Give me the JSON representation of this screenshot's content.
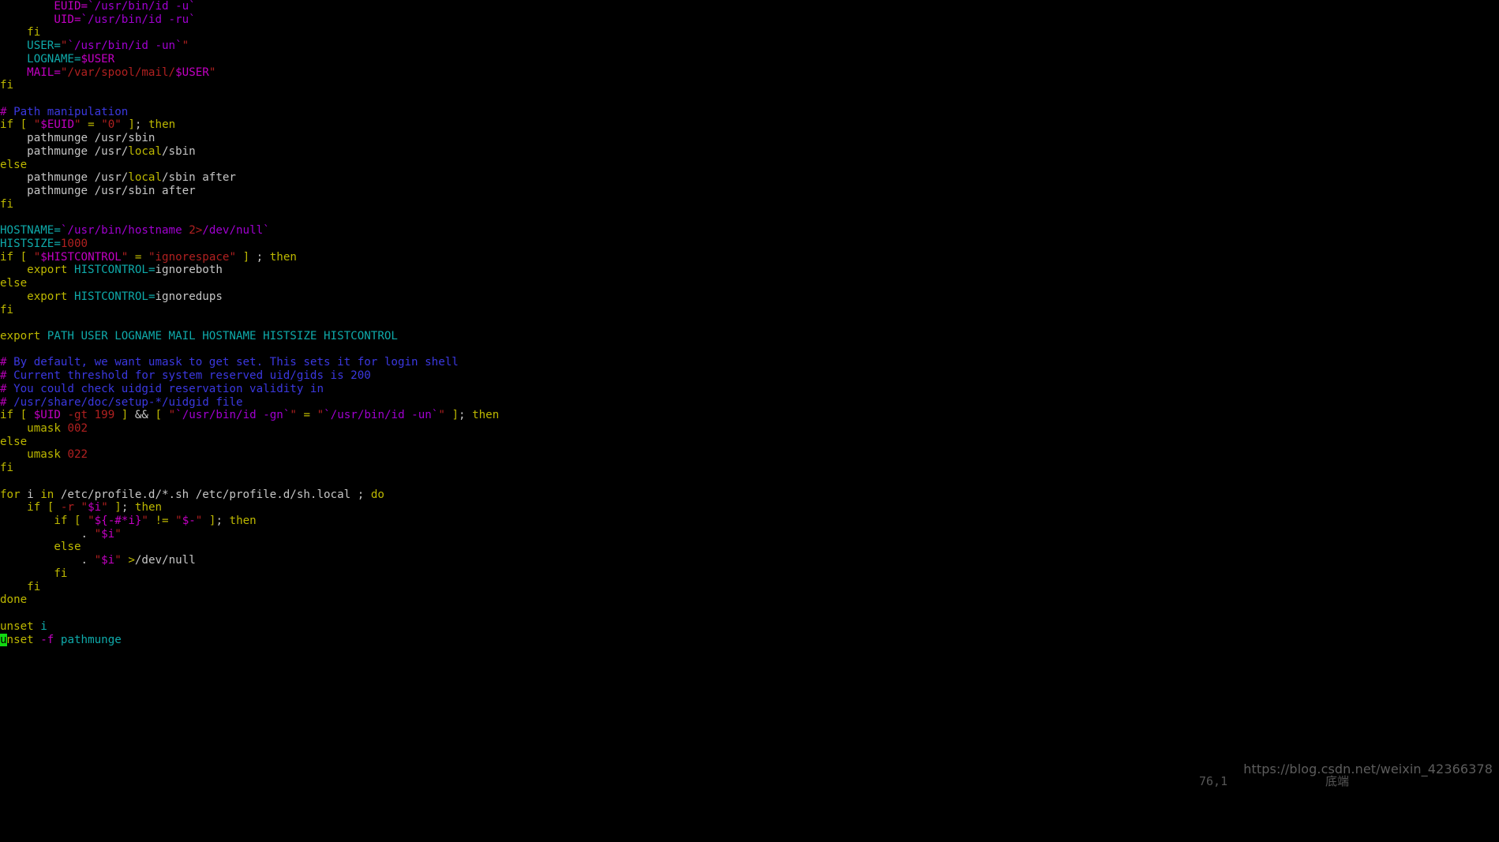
{
  "app": {
    "kind": "terminal-text-editor",
    "editor": "vim",
    "background": "#000000",
    "file_language": "shell"
  },
  "palette": {
    "keyword": "#bdb800",
    "comment": "#3b38e0",
    "comment_hash": "#b000b0",
    "identifier": "#0faaaa",
    "variable": "#c300c3",
    "string": "#b02020",
    "number": "#b02020",
    "backquote": "#a000d0",
    "plain": "#c6c6c6",
    "cursor": "#12d912"
  },
  "statusline": {
    "position": "76,1",
    "scroll": "底端"
  },
  "watermark": {
    "text": "https://blog.csdn.net/weixin_42366378"
  },
  "cursor": {
    "line": 76,
    "column": 1,
    "char": "u"
  },
  "buffer": {
    "lines": [
      "        EUID=`/usr/bin/id -u`",
      "        UID=`/usr/bin/id -ru`",
      "    fi",
      "    USER=\"`/usr/bin/id -un`\"",
      "    LOGNAME=$USER",
      "    MAIL=\"/var/spool/mail/$USER\"",
      "fi",
      "",
      "# Path manipulation",
      "if [ \"$EUID\" = \"0\" ]; then",
      "    pathmunge /usr/sbin",
      "    pathmunge /usr/local/sbin",
      "else",
      "    pathmunge /usr/local/sbin after",
      "    pathmunge /usr/sbin after",
      "fi",
      "",
      "HOSTNAME=`/usr/bin/hostname 2>/dev/null`",
      "HISTSIZE=1000",
      "if [ \"$HISTCONTROL\" = \"ignorespace\" ] ; then",
      "    export HISTCONTROL=ignoreboth",
      "else",
      "    export HISTCONTROL=ignoredups",
      "fi",
      "",
      "export PATH USER LOGNAME MAIL HOSTNAME HISTSIZE HISTCONTROL",
      "",
      "# By default, we want umask to get set. This sets it for login shell",
      "# Current threshold for system reserved uid/gids is 200",
      "# You could check uidgid reservation validity in",
      "# /usr/share/doc/setup-*/uidgid file",
      "if [ $UID -gt 199 ] && [ \"`/usr/bin/id -gn`\" = \"`/usr/bin/id -un`\" ]; then",
      "    umask 002",
      "else",
      "    umask 022",
      "fi",
      "",
      "for i in /etc/profile.d/*.sh /etc/profile.d/sh.local ; do",
      "    if [ -r \"$i\" ]; then",
      "        if [ \"${-#*i}\" != \"$-\" ]; then",
      "            . \"$i\"",
      "        else",
      "            . \"$i\" >/dev/null",
      "        fi",
      "    fi",
      "done",
      "",
      "unset i",
      "unset -f pathmunge"
    ],
    "tokens": [
      [
        [
          "plain",
          "        "
        ],
        [
          "var",
          "EUID"
        ],
        [
          "var",
          "="
        ],
        [
          "bq",
          "`/usr/bin/id -u`"
        ]
      ],
      [
        [
          "plain",
          "        "
        ],
        [
          "var",
          "UID"
        ],
        [
          "var",
          "="
        ],
        [
          "bq",
          "`/usr/bin/id -ru`"
        ]
      ],
      [
        [
          "plain",
          "    "
        ],
        [
          "kw",
          "fi"
        ]
      ],
      [
        [
          "plain",
          "    "
        ],
        [
          "ident",
          "USER"
        ],
        [
          "ident",
          "="
        ],
        [
          "str",
          "\""
        ],
        [
          "bq",
          "`/usr/bin/id -un`"
        ],
        [
          "str",
          "\""
        ]
      ],
      [
        [
          "plain",
          "    "
        ],
        [
          "ident",
          "LOGNAME"
        ],
        [
          "ident",
          "="
        ],
        [
          "var",
          "$USER"
        ]
      ],
      [
        [
          "plain",
          "    "
        ],
        [
          "var",
          "MAIL"
        ],
        [
          "var",
          "="
        ],
        [
          "str",
          "\"/var/spool/mail/"
        ],
        [
          "var",
          "$USER"
        ],
        [
          "str",
          "\""
        ]
      ],
      [
        [
          "kw",
          "fi"
        ]
      ],
      [
        [
          "plain",
          ""
        ]
      ],
      [
        [
          "cmth",
          "#"
        ],
        [
          "cmt",
          " Path manipulation"
        ]
      ],
      [
        [
          "kw",
          "if"
        ],
        [
          "plain",
          " "
        ],
        [
          "op",
          "["
        ],
        [
          "plain",
          " "
        ],
        [
          "str",
          "\""
        ],
        [
          "var",
          "$EUID"
        ],
        [
          "str",
          "\""
        ],
        [
          "plain",
          " "
        ],
        [
          "op",
          "="
        ],
        [
          "plain",
          " "
        ],
        [
          "str",
          "\"0\""
        ],
        [
          "plain",
          " "
        ],
        [
          "op",
          "]"
        ],
        [
          "plain",
          ";"
        ],
        [
          "plain",
          " "
        ],
        [
          "kw",
          "then"
        ]
      ],
      [
        [
          "plain",
          "    pathmunge /usr/"
        ],
        [
          "plain",
          "sbin"
        ]
      ],
      [
        [
          "plain",
          "    pathmunge /usr/"
        ],
        [
          "pth",
          "local"
        ],
        [
          "plain",
          "/sbin"
        ]
      ],
      [
        [
          "kw",
          "else"
        ]
      ],
      [
        [
          "plain",
          "    pathmunge /usr/"
        ],
        [
          "pth",
          "local"
        ],
        [
          "plain",
          "/sbin after"
        ]
      ],
      [
        [
          "plain",
          "    pathmunge /usr/sbin after"
        ]
      ],
      [
        [
          "kw",
          "fi"
        ]
      ],
      [
        [
          "plain",
          ""
        ]
      ],
      [
        [
          "ident",
          "HOSTNAME"
        ],
        [
          "ident",
          "="
        ],
        [
          "bq",
          "`/usr/bin/hostname "
        ],
        [
          "redir",
          "2>"
        ],
        [
          "bq",
          "/dev/null`"
        ]
      ],
      [
        [
          "ident",
          "HISTSIZE"
        ],
        [
          "ident",
          "="
        ],
        [
          "num",
          "1000"
        ]
      ],
      [
        [
          "kw",
          "if"
        ],
        [
          "plain",
          " "
        ],
        [
          "op",
          "["
        ],
        [
          "plain",
          " "
        ],
        [
          "str",
          "\""
        ],
        [
          "var",
          "$HISTCONTROL"
        ],
        [
          "str",
          "\""
        ],
        [
          "plain",
          " "
        ],
        [
          "op",
          "="
        ],
        [
          "plain",
          " "
        ],
        [
          "str",
          "\"ignorespace\""
        ],
        [
          "plain",
          " "
        ],
        [
          "op",
          "]"
        ],
        [
          "plain",
          " ;"
        ],
        [
          "plain",
          " "
        ],
        [
          "kw",
          "then"
        ]
      ],
      [
        [
          "plain",
          "    "
        ],
        [
          "kw",
          "export"
        ],
        [
          "plain",
          " "
        ],
        [
          "ident",
          "HISTCONTROL"
        ],
        [
          "ident",
          "="
        ],
        [
          "plain",
          "ignoreboth"
        ]
      ],
      [
        [
          "kw",
          "else"
        ]
      ],
      [
        [
          "plain",
          "    "
        ],
        [
          "kw",
          "export"
        ],
        [
          "plain",
          " "
        ],
        [
          "ident",
          "HISTCONTROL"
        ],
        [
          "ident",
          "="
        ],
        [
          "plain",
          "ignoredups"
        ]
      ],
      [
        [
          "kw",
          "fi"
        ]
      ],
      [
        [
          "plain",
          ""
        ]
      ],
      [
        [
          "kw",
          "export"
        ],
        [
          "plain",
          " "
        ],
        [
          "ident",
          "PATH USER LOGNAME MAIL HOSTNAME HISTSIZE HISTCONTROL"
        ]
      ],
      [
        [
          "plain",
          ""
        ]
      ],
      [
        [
          "cmth",
          "#"
        ],
        [
          "cmt",
          " By default, we want umask to get set. This sets it for login shell"
        ]
      ],
      [
        [
          "cmth",
          "#"
        ],
        [
          "cmt",
          " Current threshold for system reserved uid/gids is 200"
        ]
      ],
      [
        [
          "cmth",
          "#"
        ],
        [
          "cmt",
          " You could check uidgid reservation validity in"
        ]
      ],
      [
        [
          "cmth",
          "#"
        ],
        [
          "cmt",
          " /usr/share/doc/setup-*/uidgid file"
        ]
      ],
      [
        [
          "kw",
          "if"
        ],
        [
          "plain",
          " "
        ],
        [
          "op",
          "["
        ],
        [
          "plain",
          " "
        ],
        [
          "var",
          "$UID"
        ],
        [
          "plain",
          " "
        ],
        [
          "opt",
          "-gt"
        ],
        [
          "plain",
          " "
        ],
        [
          "num",
          "199"
        ],
        [
          "plain",
          " "
        ],
        [
          "op",
          "]"
        ],
        [
          "plain",
          " "
        ],
        [
          "plain",
          "&&"
        ],
        [
          "plain",
          " "
        ],
        [
          "op",
          "["
        ],
        [
          "plain",
          " "
        ],
        [
          "str",
          "\""
        ],
        [
          "bq",
          "`/usr/bin/id -gn`"
        ],
        [
          "str",
          "\""
        ],
        [
          "plain",
          " "
        ],
        [
          "op",
          "="
        ],
        [
          "plain",
          " "
        ],
        [
          "str",
          "\""
        ],
        [
          "bq",
          "`/usr/bin/id -un`"
        ],
        [
          "str",
          "\""
        ],
        [
          "plain",
          " "
        ],
        [
          "op",
          "]"
        ],
        [
          "plain",
          ";"
        ],
        [
          "plain",
          " "
        ],
        [
          "kw",
          "then"
        ]
      ],
      [
        [
          "plain",
          "    "
        ],
        [
          "kw",
          "umask"
        ],
        [
          "plain",
          " "
        ],
        [
          "num",
          "002"
        ]
      ],
      [
        [
          "kw",
          "else"
        ]
      ],
      [
        [
          "plain",
          "    "
        ],
        [
          "kw",
          "umask"
        ],
        [
          "plain",
          " "
        ],
        [
          "num",
          "022"
        ]
      ],
      [
        [
          "kw",
          "fi"
        ]
      ],
      [
        [
          "plain",
          ""
        ]
      ],
      [
        [
          "kw",
          "for"
        ],
        [
          "plain",
          " i "
        ],
        [
          "kw",
          "in"
        ],
        [
          "plain",
          " /etc/profile.d/*.sh /etc/profile.d/sh.local ; "
        ],
        [
          "kw",
          "do"
        ]
      ],
      [
        [
          "plain",
          "    "
        ],
        [
          "kw",
          "if"
        ],
        [
          "plain",
          " "
        ],
        [
          "op",
          "["
        ],
        [
          "plain",
          " "
        ],
        [
          "opt",
          "-r"
        ],
        [
          "plain",
          " "
        ],
        [
          "str",
          "\""
        ],
        [
          "var",
          "$i"
        ],
        [
          "str",
          "\""
        ],
        [
          "plain",
          " "
        ],
        [
          "op",
          "]"
        ],
        [
          "plain",
          ";"
        ],
        [
          "plain",
          " "
        ],
        [
          "kw",
          "then"
        ]
      ],
      [
        [
          "plain",
          "        "
        ],
        [
          "kw",
          "if"
        ],
        [
          "plain",
          " "
        ],
        [
          "op",
          "["
        ],
        [
          "plain",
          " "
        ],
        [
          "str",
          "\""
        ],
        [
          "var",
          "${-#*i}"
        ],
        [
          "str",
          "\""
        ],
        [
          "plain",
          " "
        ],
        [
          "op",
          "!="
        ],
        [
          "plain",
          " "
        ],
        [
          "str",
          "\""
        ],
        [
          "var",
          "$-"
        ],
        [
          "str",
          "\""
        ],
        [
          "plain",
          " "
        ],
        [
          "op",
          "]"
        ],
        [
          "plain",
          ";"
        ],
        [
          "plain",
          " "
        ],
        [
          "kw",
          "then"
        ]
      ],
      [
        [
          "plain",
          "            . "
        ],
        [
          "str",
          "\""
        ],
        [
          "var",
          "$i"
        ],
        [
          "str",
          "\""
        ]
      ],
      [
        [
          "plain",
          "        "
        ],
        [
          "kw",
          "else"
        ]
      ],
      [
        [
          "plain",
          "            . "
        ],
        [
          "str",
          "\""
        ],
        [
          "var",
          "$i"
        ],
        [
          "str",
          "\""
        ],
        [
          "plain",
          " "
        ],
        [
          "redg",
          ">"
        ],
        [
          "plain",
          "/dev/null"
        ]
      ],
      [
        [
          "plain",
          "        "
        ],
        [
          "kw",
          "fi"
        ]
      ],
      [
        [
          "plain",
          "    "
        ],
        [
          "kw",
          "fi"
        ]
      ],
      [
        [
          "kw",
          "done"
        ]
      ],
      [
        [
          "plain",
          ""
        ]
      ],
      [
        [
          "kw",
          "unset"
        ],
        [
          "plain",
          " "
        ],
        [
          "ident",
          "i"
        ]
      ],
      [
        [
          "kw",
          "unset"
        ],
        [
          "plain",
          " "
        ],
        [
          "optm",
          "-f"
        ],
        [
          "plain",
          " "
        ],
        [
          "ident",
          "pathmunge"
        ]
      ]
    ]
  }
}
